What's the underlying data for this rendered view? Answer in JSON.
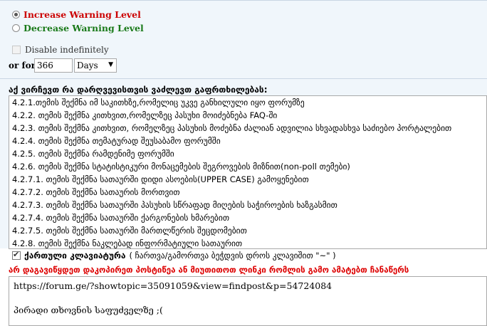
{
  "warning_level": {
    "increase_label": "Increase Warning Level",
    "decrease_label": "Decrease Warning Level",
    "increase_color": "#cc0000",
    "decrease_color": "#1a7a1a",
    "selected": "increase"
  },
  "duration": {
    "disable_label": "Disable indefinitely",
    "or_for_label": "or for",
    "amount_value": "366",
    "unit_selected": "Days"
  },
  "reasons": {
    "heading": "აქ ვირჩევთ რა დარღვევისთვის ვაძლევთ გაფრთხილებას:",
    "items": [
      "4.2.1.თემის შექმნა იმ საკითხზე,რომელიც უკვე განხილული იყო ფორუმზე",
      "4.2.2. თემის შექმნა კითხვით,რომელზეც პასუხი მოიძებნება FAQ-ში",
      "4.2.3. თემის შექმნა კითხვით, რომელზეც პასუხის მოძებნა ძალიან ადვილია სხვადასხვა საძიებო პორტალებით",
      "4.2.4. თემის შექმნა თემატურად შეუსაბამო ფორუმში",
      "4.2.5. თემის შექმნა რამდენიმე ფორუმში",
      "4.2.6. თემის შექმნა სტატისტიკური მონაცემების შეგროვების მიზნით(non-poll თემები)",
      "4.2.7.1. თემის შექმნა სათაურში დიდი ასოების(UPPER CASE) გამოყენებით",
      "4.2.7.2. თემის შექმნა სათაურის მორთვით",
      "4.2.7.3. თემის შექმნა სათაურში პასუხის სწრაფად მიღების საჭიროების ხაზგასმით",
      "4.2.7.4. თემის შექმნა სათაურში ქარგონების ხმარებით",
      "4.2.7.5. თემის შექმნა სათაურში მართლწერის შეცდომებით",
      "4.2.8. თემის შექმნა ნაკლებად ინფორმატიული სათაურით"
    ]
  },
  "keyboard": {
    "label": "ქართული კლავიატურა",
    "note": "( ჩართვა/გამორთვა ბეჭდვის დროს კლავიშით \"~\" )",
    "checked": true
  },
  "warning_note": "არ დაგავიწყდეთ დაკოპირეთ პოსტიწეა ან მიუთითოთ ლინკი რომლის გამო ამატებთ ჩანაწერს",
  "message": {
    "lines": [
      "https://forum.ge/?showtopic=35091059&view=findpost&p=54724084",
      "",
      "პირადი თხოვნის საფუძველზე ;("
    ]
  }
}
